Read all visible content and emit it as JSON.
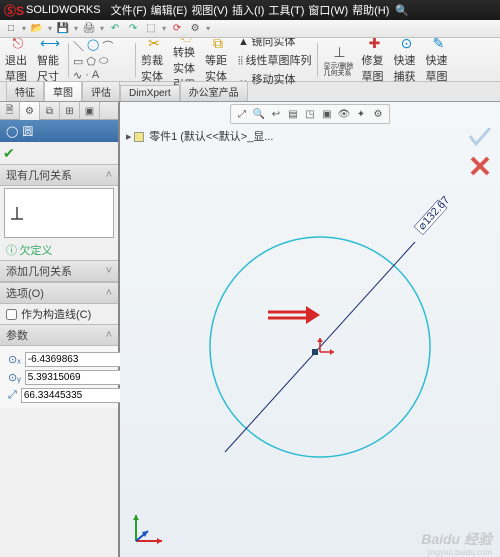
{
  "app": {
    "title": "SOLIDWORKS"
  },
  "menu": {
    "file": "文件(F)",
    "edit": "编辑(E)",
    "view": "视图(V)",
    "insert": "插入(I)",
    "tools": "工具(T)",
    "window": "窗口(W)",
    "help": "帮助(H)"
  },
  "cmdmgr": {
    "exit_sketch": "退出草图",
    "smart_dim": "智能尺寸",
    "trim": "剪裁实体",
    "convert": "转换实体引用",
    "offset": "等距实体",
    "mirror": "镜向实体",
    "pattern": "线性草图阵列",
    "move": "移动实体",
    "show_rel": "显示/删除几何关系",
    "repair": "修复草图",
    "quick_snap": "快速捕获",
    "rapid": "快速草图"
  },
  "tabs": {
    "feature": "特征",
    "sketch": "草图",
    "evaluate": "评估",
    "dimxpert": "DimXpert",
    "office": "办公室产品"
  },
  "propmgr": {
    "title": "圆",
    "existing_rel": "现有几何关系",
    "add_rel": "添加几何关系",
    "options": "选项(O)",
    "construction": "作为构造线(C)",
    "params": "参数"
  },
  "circle": {
    "cx": "-6.4369863",
    "cy": "5.39315069",
    "r": "66.33445335",
    "dim_label": "132.67"
  },
  "doc": {
    "name": "零件1   (默认<<默认>_显..."
  },
  "watermark": {
    "main": "Baidu 经验",
    "sub": "jingyan.baidu.com"
  }
}
